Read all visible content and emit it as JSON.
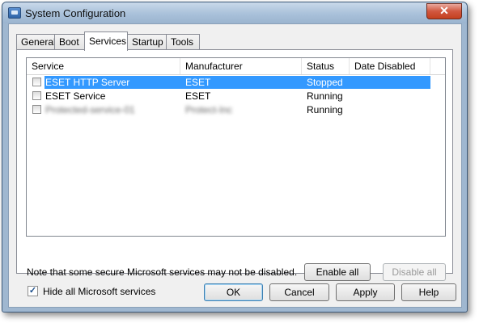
{
  "window": {
    "title": "System Configuration",
    "close_glyph": "✕"
  },
  "tabs": [
    "General",
    "Boot",
    "Services",
    "Startup",
    "Tools"
  ],
  "active_tab": "Services",
  "columns": [
    "Service",
    "Manufacturer",
    "Status",
    "Date Disabled"
  ],
  "rows": [
    {
      "service": "ESET HTTP Server",
      "manufacturer": "ESET",
      "status": "Stopped",
      "date_disabled": "",
      "checked": false,
      "selected": true
    },
    {
      "service": "ESET Service",
      "manufacturer": "ESET",
      "status": "Running",
      "date_disabled": "",
      "checked": false,
      "selected": false
    },
    {
      "service": "Protected-service-01",
      "manufacturer": "Protect-Inc",
      "status": "Running",
      "date_disabled": "",
      "checked": false,
      "selected": false,
      "obscured": true
    }
  ],
  "note": "Note that some secure Microsoft services may not be disabled.",
  "buttons": {
    "enable_all": "Enable all",
    "disable_all": "Disable all",
    "ok": "OK",
    "cancel": "Cancel",
    "apply": "Apply",
    "help": "Help"
  },
  "hide_ms": {
    "label": "Hide all Microsoft services",
    "checked": true,
    "check_glyph": "✓"
  },
  "colors": {
    "selection": "#3399ff",
    "close": "#c4401f"
  },
  "icons": [
    "system-config-icon",
    "close-icon",
    "checkbox-icon"
  ]
}
